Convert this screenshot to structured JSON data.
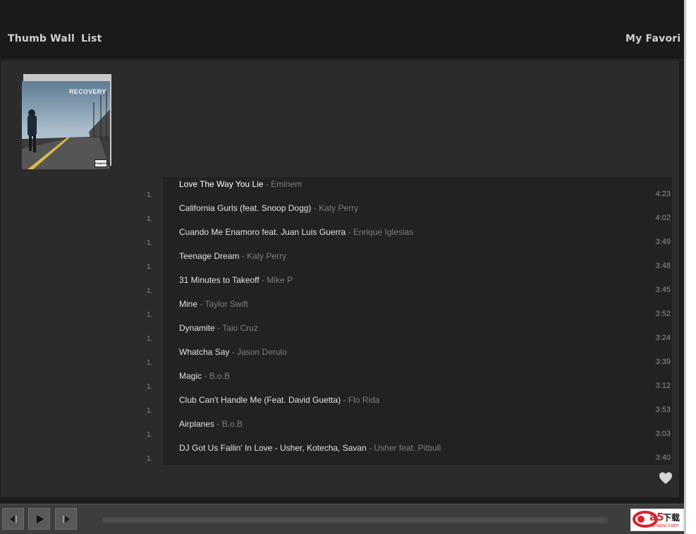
{
  "nav": {
    "thumb_wall": "Thumb Wall",
    "list": "List",
    "favorites": "My Favorites"
  },
  "album": {
    "title": "RECOVERY",
    "badge": "PARENTAL ADVISORY"
  },
  "tracks": [
    {
      "num": "1.",
      "title": "Love The Way You Lie",
      "sep": " - ",
      "artist": "Eminem",
      "duration": "4:23"
    },
    {
      "num": "1.",
      "title": "California Gurls (feat. Snoop Dogg)",
      "sep": " - ",
      "artist": "Katy Perry",
      "duration": "4:02"
    },
    {
      "num": "1.",
      "title": "Cuando Me Enamoro feat. Juan Luis Guerra",
      "sep": " - ",
      "artist": "Enrique Iglesias",
      "duration": "3:49"
    },
    {
      "num": "1.",
      "title": "Teenage Dream",
      "sep": " - ",
      "artist": "Katy Perry",
      "duration": "3:48"
    },
    {
      "num": "1.",
      "title": "31 Minutes to Takeoff",
      "sep": " - ",
      "artist": "Mike P",
      "duration": "3:45"
    },
    {
      "num": "1.",
      "title": "Mine",
      "sep": " - ",
      "artist": "Taylor Swift",
      "duration": "3:52"
    },
    {
      "num": "1.",
      "title": "Dynamite",
      "sep": " - ",
      "artist": "Taio Cruz",
      "duration": "3:24"
    },
    {
      "num": "1.",
      "title": "Whatcha Say",
      "sep": " - ",
      "artist": "Jason Derulo",
      "duration": "3:39"
    },
    {
      "num": "1.",
      "title": "Magic",
      "sep": " - ",
      "artist": "B.o.B",
      "duration": "3:12"
    },
    {
      "num": "1.",
      "title": "Club Can't Handle Me (Feat. David Guetta)",
      "sep": " - ",
      "artist": "Flo Rida",
      "duration": "3:53"
    },
    {
      "num": "1.",
      "title": "Airplanes",
      "sep": " - ",
      "artist": "B.o.B",
      "duration": "3:03"
    },
    {
      "num": "1.",
      "title": "DJ Got Us Fallin' In Love - Usher, Kotecha, Savan",
      "sep": " - ",
      "artist": "Usher feat. Pitbull",
      "duration": "3:40"
    }
  ],
  "player": {
    "prev_icon": "skip-back-icon",
    "play_icon": "play-icon",
    "next_icon": "skip-forward-icon",
    "favorite_icon": "heart-icon",
    "progress": 0
  },
  "logo": {
    "mark": "a5",
    "cn": "下载",
    "site": "xiazai.com"
  },
  "colors": {
    "background": "#1c1c1c",
    "panel": "#2b2b2b",
    "list": "#222222",
    "title_text": "#e2e2e2",
    "artist_text": "#7d7d7d",
    "logo_red": "#d8232a"
  }
}
